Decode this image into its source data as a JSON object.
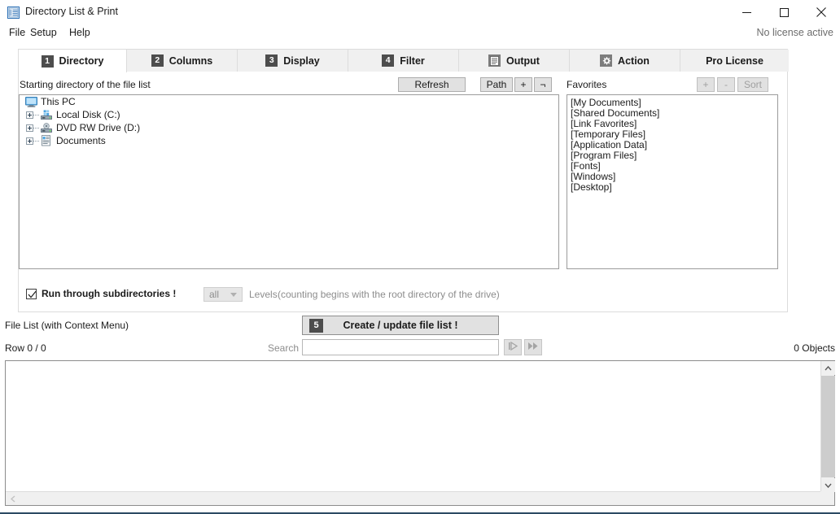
{
  "window": {
    "title": "Directory List & Print",
    "app_icon": "list-document-icon",
    "minimize_label": "–",
    "maximize_label": "□",
    "close_label": "✕"
  },
  "menu": {
    "items": [
      {
        "label": "File",
        "name": "menu-file"
      },
      {
        "label": "Setup",
        "name": "menu-setup"
      },
      {
        "label": "Help",
        "name": "menu-help"
      }
    ],
    "license_note": "No license active"
  },
  "tabs": [
    {
      "num": "1",
      "label": "Directory",
      "icon": "",
      "active": true
    },
    {
      "num": "2",
      "label": "Columns",
      "icon": "",
      "active": false
    },
    {
      "num": "3",
      "label": "Display",
      "icon": "",
      "active": false
    },
    {
      "num": "4",
      "label": "Filter",
      "icon": "",
      "active": false
    },
    {
      "num": "",
      "label": "Output",
      "icon": "document-icon",
      "active": false
    },
    {
      "num": "",
      "label": "Action",
      "icon": "gear-icon",
      "active": false
    },
    {
      "num": "",
      "label": "Pro License",
      "icon": "",
      "active": false
    }
  ],
  "directory_tab": {
    "starting_dir_label": "Starting directory of the file list",
    "refresh_label": "Refresh",
    "path_label": "Path",
    "plus_label": "+",
    "not_label": "¬",
    "favorites_label": "Favorites",
    "fav_add_label": "+",
    "fav_remove_label": "-",
    "fav_sort_label": "Sort",
    "tree": [
      {
        "label": "This PC",
        "icon": "monitor-icon",
        "level": 0,
        "expander": false
      },
      {
        "label": "Local Disk (C:)",
        "icon": "harddisk-icon",
        "level": 1,
        "expander": true
      },
      {
        "label": "DVD RW Drive (D:)",
        "icon": "dvddrive-icon",
        "level": 1,
        "expander": true
      },
      {
        "label": "Documents",
        "icon": "documents-icon",
        "level": 1,
        "expander": true
      }
    ],
    "favorites": [
      "[My Documents]",
      "[Shared Documents]",
      "[Link Favorites]",
      "[Temporary Files]",
      "[Application Data]",
      "[Program Files]",
      "[Fonts]",
      "[Windows]",
      "[Desktop]"
    ],
    "subdirs_checkbox_label": "Run through subdirectories !",
    "subdirs_checked": true,
    "levels_value": "all",
    "levels_label": "Levels",
    "levels_hint": "(counting begins with the root directory of the drive)"
  },
  "filelist_section": {
    "title": "File List (with Context Menu)",
    "create_button_num": "5",
    "create_button_label": "Create / update file list !",
    "row_status": "Row 0 / 0",
    "search_label": "Search",
    "search_value": "",
    "search_placeholder": "",
    "find_next_icon": "play-step-icon",
    "find_all_icon": "fast-forward-icon",
    "objects_count": "0 Objects"
  },
  "colors": {
    "accent_dark": "#4d4d4d",
    "panel_bg": "#f0f0f0",
    "window_bg": "#ffffff",
    "border": "#dcdcdc",
    "bottom_rule": "#2b4a63"
  }
}
